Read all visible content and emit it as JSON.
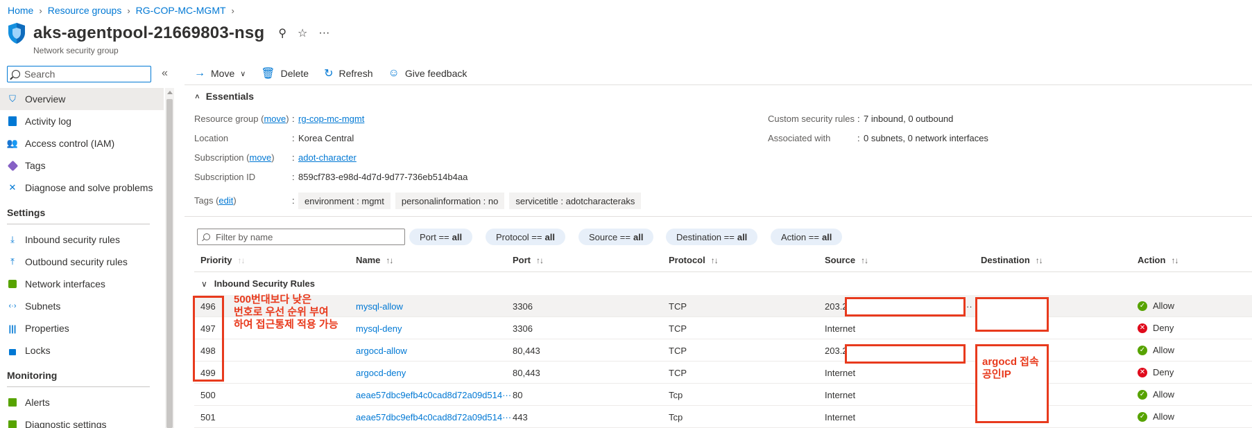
{
  "breadcrumb": [
    "Home",
    "Resource groups",
    "RG-COP-MC-MGMT"
  ],
  "title": "aks-agentpool-21669803-nsg",
  "subtitle": "Network security group",
  "title_actions": {
    "pin": "⚲",
    "star": "☆",
    "more": "···"
  },
  "search": {
    "value": "Search"
  },
  "sidebar": {
    "items": [
      {
        "label": "Overview",
        "icon": "shield-icon"
      },
      {
        "label": "Activity log",
        "icon": "activity-log-icon"
      },
      {
        "label": "Access control (IAM)",
        "icon": "people-icon"
      },
      {
        "label": "Tags",
        "icon": "tag-icon"
      },
      {
        "label": "Diagnose and solve problems",
        "icon": "wrench-icon"
      }
    ],
    "settings_heading": "Settings",
    "settings_items": [
      {
        "label": "Inbound security rules",
        "icon": "inbound-icon"
      },
      {
        "label": "Outbound security rules",
        "icon": "outbound-icon"
      },
      {
        "label": "Network interfaces",
        "icon": "nic-icon"
      },
      {
        "label": "Subnets",
        "icon": "subnet-icon"
      },
      {
        "label": "Properties",
        "icon": "properties-icon"
      },
      {
        "label": "Locks",
        "icon": "lock-icon"
      }
    ],
    "monitoring_heading": "Monitoring",
    "monitoring_items": [
      {
        "label": "Alerts",
        "icon": "alerts-icon"
      },
      {
        "label": "Diagnostic settings",
        "icon": "diagnostic-icon"
      }
    ]
  },
  "toolbar": {
    "move": "Move",
    "delete": "Delete",
    "refresh": "Refresh",
    "feedback": "Give feedback"
  },
  "essentials": {
    "heading": "Essentials",
    "resource_group_label": "Resource group",
    "move_link": "move",
    "resource_group_value": "rg-cop-mc-mgmt",
    "location_label": "Location",
    "location_value": "Korea Central",
    "subscription_label": "Subscription",
    "subscription_value": "adot-character",
    "subscription_id_label": "Subscription ID",
    "subscription_id_value": "859cf783-e98d-4d7d-9d77-736eb514b4aa",
    "tags_label": "Tags",
    "edit_link": "edit",
    "tags": [
      "environment : mgmt",
      "personalinformation : no",
      "servicetitle : adotcharacteraks"
    ],
    "custom_rules_label": "Custom security rules",
    "custom_rules_value": "7 inbound, 0 outbound",
    "associated_label": "Associated with",
    "associated_value": "0 subnets, 0 network interfaces"
  },
  "filter": {
    "placeholder": "Filter by name",
    "pills": [
      {
        "label": "Port ==",
        "value": "all"
      },
      {
        "label": "Protocol ==",
        "value": "all"
      },
      {
        "label": "Source ==",
        "value": "all"
      },
      {
        "label": "Destination ==",
        "value": "all"
      },
      {
        "label": "Action ==",
        "value": "all"
      }
    ]
  },
  "table": {
    "columns": [
      "Priority",
      "Name",
      "Port",
      "Protocol",
      "Source",
      "Destination",
      "Action"
    ],
    "group": "Inbound Security Rules",
    "rows": [
      {
        "priority": "496",
        "name": "mysql-allow",
        "port": "3306",
        "protocol": "TCP",
        "source": "203.2",
        "destination": "",
        "action": "Allow"
      },
      {
        "priority": "497",
        "name": "mysql-deny",
        "port": "3306",
        "protocol": "TCP",
        "source": "Internet",
        "destination": "",
        "action": "Deny"
      },
      {
        "priority": "498",
        "name": "argocd-allow",
        "port": "80,443",
        "protocol": "TCP",
        "source": "203.2",
        "destination": "",
        "action": "Allow"
      },
      {
        "priority": "499",
        "name": "argocd-deny",
        "port": "80,443",
        "protocol": "TCP",
        "source": "Internet",
        "destination": "",
        "action": "Deny"
      },
      {
        "priority": "500",
        "name": "aeae57dbc9efb4c0cad8d72a09d514···",
        "port": "80",
        "protocol": "Tcp",
        "source": "Internet",
        "destination": "",
        "action": "Allow"
      },
      {
        "priority": "501",
        "name": "aeae57dbc9efb4c0cad8d72a09d514···",
        "port": "443",
        "protocol": "Tcp",
        "source": "Internet",
        "destination": "",
        "action": "Allow"
      }
    ]
  },
  "annotations": {
    "priority_note": [
      "500번대보다 낮은",
      "번호로 우선 순위 부여",
      "하여 접근통제 적용 가능"
    ],
    "argocd_note": [
      "argocd 접속",
      "공인IP"
    ]
  },
  "colors": {
    "annotation_red": "#e83a1d",
    "link_blue": "#0078d4",
    "allow_green": "#57a300",
    "deny_red": "#e00b1c"
  }
}
